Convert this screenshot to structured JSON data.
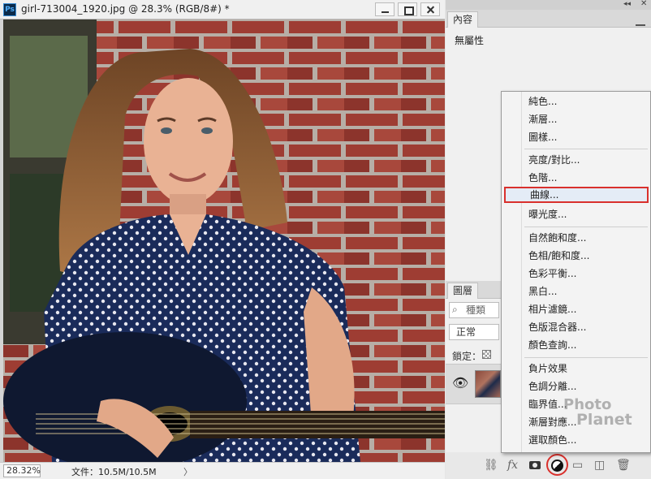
{
  "document": {
    "app_icon": "Ps",
    "title": "girl-713004_1920.jpg @ 28.3% (RGB/8#) *",
    "zoom": "28.32%",
    "file_info": "文件：10.5M/10.5M",
    "status_arrow": "〉"
  },
  "properties_panel": {
    "tab_label": "內容",
    "empty_text": "無屬性"
  },
  "layers_panel": {
    "tab_label": "圖層",
    "filter_placeholder": "種類",
    "blend_mode": "正常",
    "lock_label": "鎖定："
  },
  "adjustment_menu": {
    "items": [
      "純色...",
      "漸層...",
      "圖樣...",
      "亮度/對比...",
      "色階...",
      "曲線...",
      "曝光度...",
      "自然飽和度...",
      "色相/飽和度...",
      "色彩平衡...",
      "黑白...",
      "相片濾鏡...",
      "色版混合器...",
      "顏色查詢...",
      "負片效果",
      "色調分離...",
      "臨界值...",
      "漸層對應...",
      "選取顏色..."
    ],
    "highlighted": "曲線..."
  },
  "watermark": {
    "line1": "Photo",
    "line2": "Planet"
  },
  "colors": {
    "highlight_border": "#d9302c",
    "menu_highlight_bg": "#e4ecf6"
  }
}
